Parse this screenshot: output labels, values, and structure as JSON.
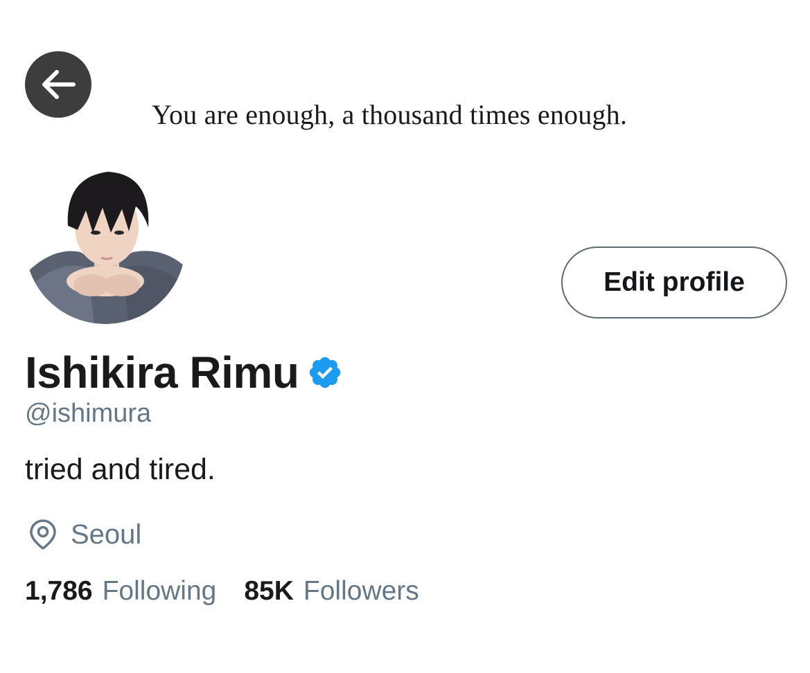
{
  "header": {
    "banner_quote": "You are enough, a thousand times enough.",
    "back_icon": "arrow-left-icon"
  },
  "profile": {
    "avatar_icon": "avatar",
    "edit_profile_label": "Edit profile",
    "display_name": "Ishikira Rimu",
    "verified_icon": "verified-badge-icon",
    "handle": "@ishimura",
    "bio": "tried and tired.",
    "location_icon": "location-pin-icon",
    "location": "Seoul"
  },
  "stats": {
    "following_count": "1,786",
    "following_label": "Following",
    "followers_count": "85K",
    "followers_label": "Followers"
  },
  "colors": {
    "text_primary": "#14171a",
    "text_secondary": "#657786",
    "verified_blue": "#1da1f2",
    "back_button_bg": "#3d3d3e",
    "button_border": "#5f6a73"
  }
}
